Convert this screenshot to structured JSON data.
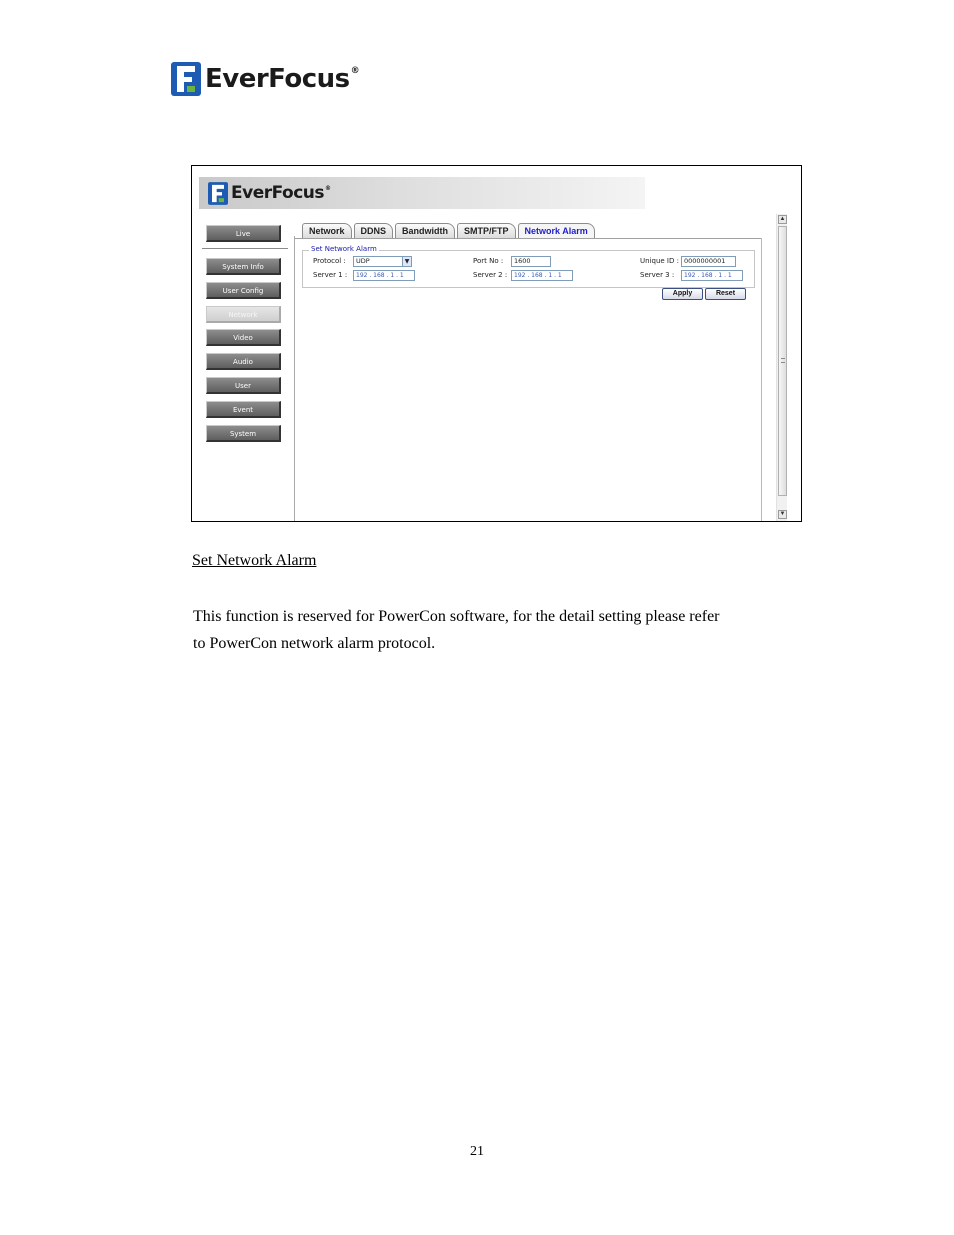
{
  "brand": {
    "name": "EverFocus",
    "reg": "®"
  },
  "screenshot": {
    "nav": [
      "Live",
      "System Info",
      "User Config",
      "Network",
      "Video",
      "Audio",
      "User",
      "Event",
      "System"
    ],
    "nav_active": "Network",
    "tabs": [
      "Network",
      "DDNS",
      "Bandwidth",
      "SMTP/FTP",
      "Network Alarm"
    ],
    "tab_active": "Network Alarm",
    "section_title": "Set Network Alarm",
    "fields": {
      "protocol_label": "Protocol :",
      "protocol_value": "UDP",
      "port_label": "Port No :",
      "port_value": "1600",
      "unique_label": "Unique ID :",
      "unique_value": "0000000001",
      "server1_label": "Server 1 :",
      "server1_value": "192 . 168 .  1  .  1",
      "server2_label": "Server 2 :",
      "server2_value": "192 . 168 .  1  .  1",
      "server3_label": "Server 3 :",
      "server3_value": "192 . 168 .  1  .  1"
    },
    "apply_label": "Apply",
    "reset_label": "Reset"
  },
  "doc": {
    "heading": "Set Network Alarm",
    "paragraph_line1": "This function is reserved for PowerCon software, for the detail setting please refer",
    "paragraph_line2": "to PowerCon network alarm protocol.",
    "page_number": "21"
  },
  "colors": {
    "logo_blue": "#1e5cb3",
    "logo_green": "#6cb33f",
    "tab_active": "#1f1fc8"
  }
}
